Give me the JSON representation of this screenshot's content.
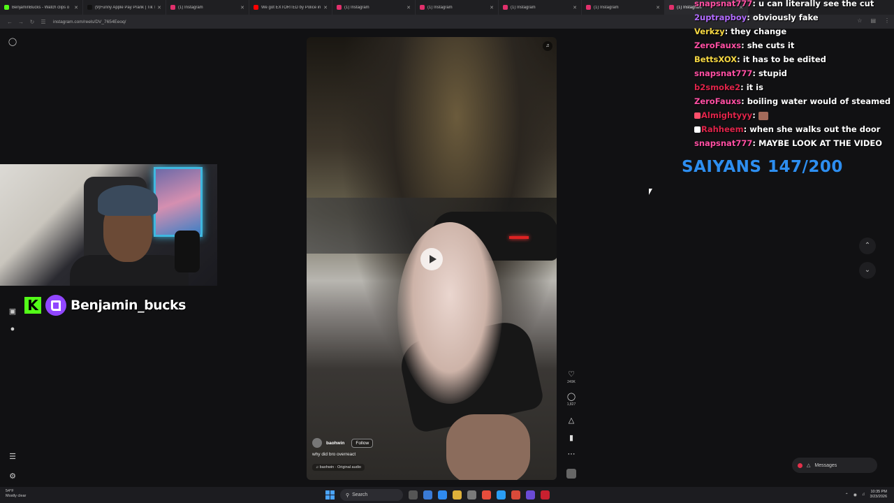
{
  "browser": {
    "tabs": [
      {
        "title": "BenjaminBucks - Watch clips o",
        "color": "#53fc18"
      },
      {
        "title": "(9)Funny Apple Pay Prank | Tik T",
        "color": "#111111"
      },
      {
        "title": "(1) Instagram",
        "color": "#e1306c"
      },
      {
        "title": "We got EXTORTED by Police in",
        "color": "#ff0000"
      },
      {
        "title": "(1) Instagram",
        "color": "#e1306c"
      },
      {
        "title": "(1) Instagram",
        "color": "#e1306c"
      },
      {
        "title": "(1) Instagram",
        "color": "#e1306c"
      },
      {
        "title": "(1) Instagram",
        "color": "#e1306c"
      },
      {
        "title": "(1) Instagram",
        "color": "#e1306c"
      }
    ],
    "url": "instagram.com/reels/DV_7654Eeoq/"
  },
  "streamer": {
    "name": "Benjamin_bucks",
    "kick_letter": "K"
  },
  "reel": {
    "author": "baohwin",
    "follow_label": "Follow",
    "caption": "why did bro overreact",
    "audio": "♫ baohwin · Original audio",
    "likes": "249K",
    "comments": "1,827"
  },
  "chat": [
    {
      "user": "snapsnat777",
      "color": "#ff4fa3",
      "msg": "u can literally see the cut"
    },
    {
      "user": "2uptrapboy",
      "color": "#b26bff",
      "msg": "obviously fake"
    },
    {
      "user": "Verkzy",
      "color": "#f5d742",
      "msg": "they change"
    },
    {
      "user": "ZeroFauxs",
      "color": "#ff4fa3",
      "msg": "she cuts it"
    },
    {
      "user": "BettsXOX",
      "color": "#f5d742",
      "msg": "it has to be edited"
    },
    {
      "user": "snapsnat777",
      "color": "#ff4fa3",
      "msg": "stupid"
    },
    {
      "user": "b2smoke2",
      "color": "#e0244a",
      "msg": "it is"
    },
    {
      "user": "ZeroFauxs",
      "color": "#ff4fa3",
      "msg": "boiling water would of steamed"
    },
    {
      "user": "Almightyyy",
      "color": "#e0244a",
      "msg": ""
    },
    {
      "user": "Rahheem",
      "color": "#e0244a",
      "msg": "when she walks out the door"
    },
    {
      "user": "snapsnat777",
      "color": "#ff4fa3",
      "msg": "MAYBE LOOK AT THE VIDEO"
    }
  ],
  "saiyans": "SAIYANS 147/200",
  "messages_label": "Messages",
  "taskbar": {
    "weather_temp": "54°F",
    "weather_desc": "Mostly clear",
    "search_label": "Search",
    "time": "10:35 PM",
    "date": "3/23/2026"
  }
}
